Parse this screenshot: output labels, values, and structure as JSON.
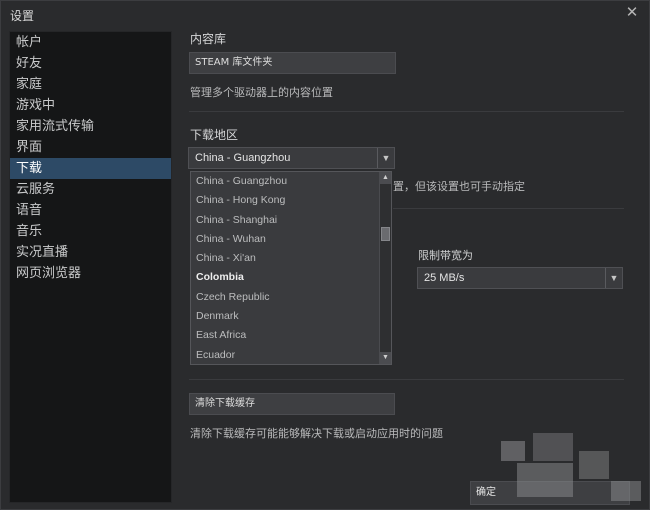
{
  "window": {
    "title": "设置",
    "close_glyph": "✕"
  },
  "sidebar": {
    "items": [
      {
        "label": "帐户"
      },
      {
        "label": "好友"
      },
      {
        "label": "家庭"
      },
      {
        "label": "游戏中"
      },
      {
        "label": "家用流式传输"
      },
      {
        "label": "界面"
      },
      {
        "label": "下载"
      },
      {
        "label": "云服务"
      },
      {
        "label": "语音"
      },
      {
        "label": "音乐"
      },
      {
        "label": "实况直播"
      },
      {
        "label": "网页浏览器"
      }
    ],
    "active_index": 6
  },
  "content_library": {
    "title": "内容库",
    "button_label": "STEAM 库文件夹",
    "description": "管理多个驱动器上的内容位置"
  },
  "download_region": {
    "title": "下载地区",
    "selected": "China - Guangzhou",
    "description_partial": "置，但该设置也可手动指定",
    "options": [
      "China - Guangzhou",
      "China - Hong Kong",
      "China - Shanghai",
      "China - Wuhan",
      "China - Xi'an",
      "Colombia",
      "Czech Republic",
      "Denmark",
      "East Africa",
      "Ecuador"
    ],
    "highlighted_option": "Colombia"
  },
  "bandwidth": {
    "label": "限制带宽为",
    "selected": "25 MB/s"
  },
  "cache": {
    "button_label": "清除下载缓存",
    "description": "清除下载缓存可能能够解决下载或启动应用时的问题"
  },
  "footer": {
    "ok_label": "确定"
  },
  "icons": {
    "dropdown_arrow": "▼",
    "scroll_up": "▲",
    "scroll_down": "▼"
  }
}
